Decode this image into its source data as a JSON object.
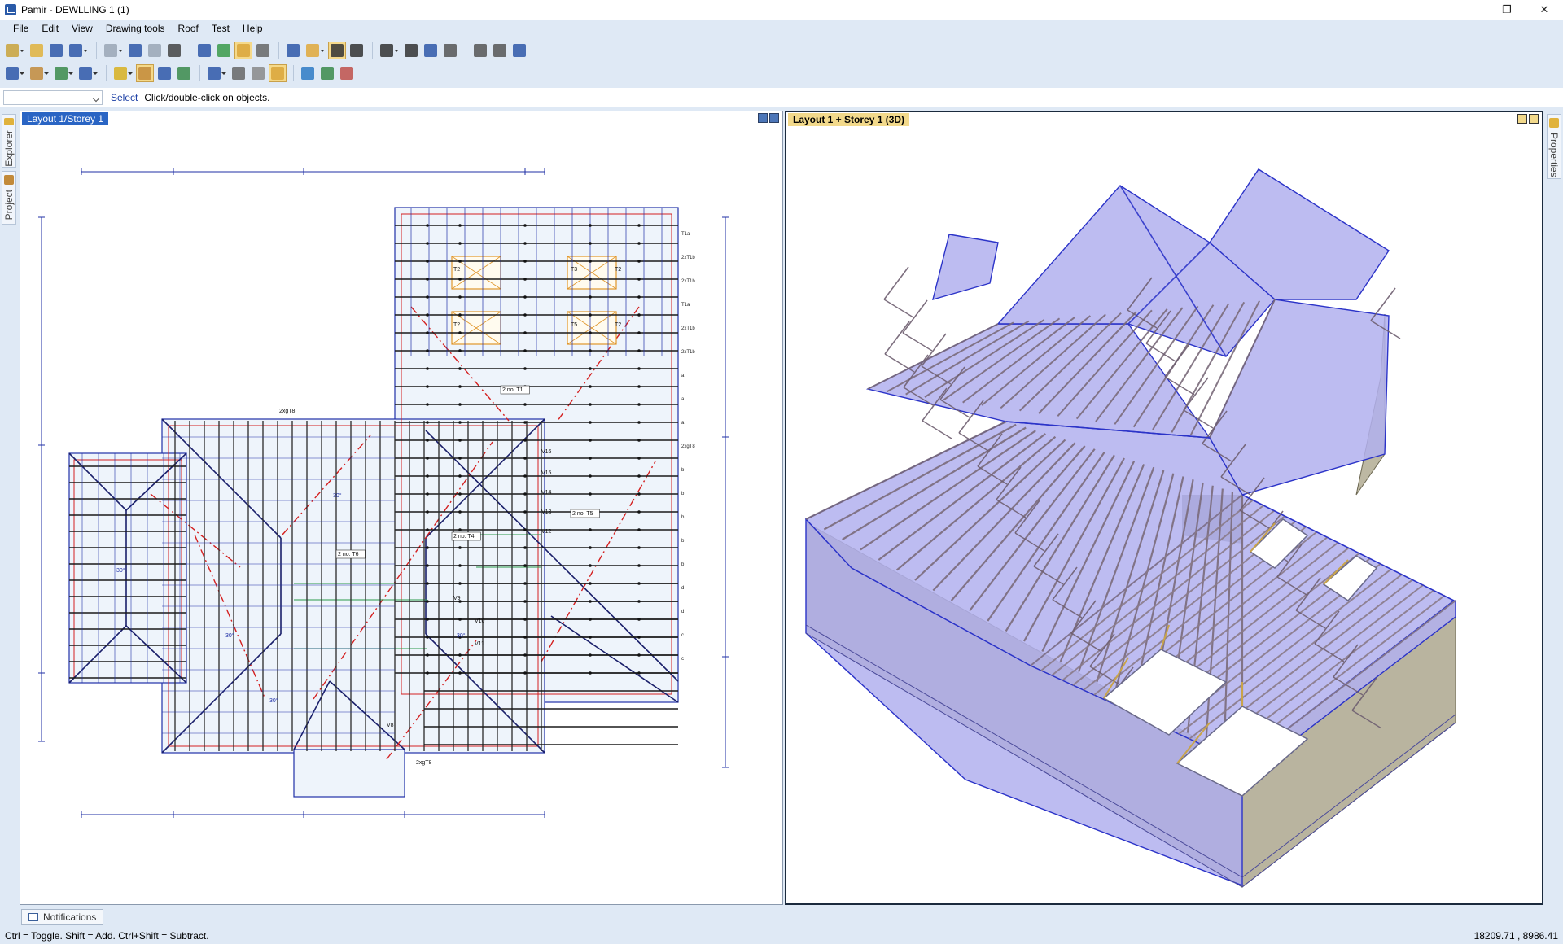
{
  "window": {
    "title": "Pamir - DEWLLING 1 (1)",
    "controls": [
      "–",
      "❐",
      "✕"
    ]
  },
  "menu": [
    "File",
    "Edit",
    "View",
    "Drawing tools",
    "Roof",
    "Test",
    "Help"
  ],
  "toolbar1": [
    {
      "icon": "new-file-icon",
      "color": "#c9a23a",
      "drop": true
    },
    {
      "icon": "open-folder-icon",
      "color": "#e0b23c"
    },
    {
      "icon": "save-icon",
      "color": "#2e57a8"
    },
    {
      "icon": "undo-icon",
      "color": "#2e57a8",
      "drop": true
    },
    {
      "icon": "redo-icon",
      "color": "#9aa6b5",
      "drop": true
    },
    {
      "icon": "copy-icon",
      "color": "#2e57a8"
    },
    {
      "icon": "paste-icon",
      "color": "#9aa6b5"
    },
    {
      "icon": "edit-icon",
      "color": "#444"
    },
    {
      "icon": "image-icon",
      "color": "#2e57a8"
    },
    {
      "icon": "roof-view-icon",
      "color": "#3a9a4a"
    },
    {
      "icon": "layers-icon",
      "color": "#d9a53a",
      "active": true
    },
    {
      "icon": "text-frame-icon",
      "color": "#666"
    },
    {
      "icon": "print-icon",
      "color": "#2e57a8"
    },
    {
      "icon": "pencil-icon",
      "color": "#e0a83a",
      "drop": true
    },
    {
      "icon": "select-cursor-icon",
      "color": "#333",
      "active": true
    },
    {
      "icon": "move-cursor-icon",
      "color": "#333"
    },
    {
      "icon": "zoom-icon",
      "color": "#333",
      "drop": true
    },
    {
      "icon": "measure-icon",
      "color": "#333"
    },
    {
      "icon": "link-icon",
      "color": "#2e57a8"
    },
    {
      "icon": "truss-icon",
      "color": "#555"
    },
    {
      "icon": "frame-icon",
      "color": "#555"
    },
    {
      "icon": "wrench-icon",
      "color": "#555"
    },
    {
      "icon": "display-icon",
      "color": "#2e57a8"
    }
  ],
  "toolbar2": [
    {
      "icon": "roof-plane-icon",
      "color": "#2e57a8",
      "drop": true
    },
    {
      "icon": "hip-roof-icon",
      "color": "#c28a3a",
      "drop": true
    },
    {
      "icon": "gable-icon",
      "color": "#3a8a4a",
      "drop": true
    },
    {
      "icon": "dormer-icon",
      "color": "#2e57a8",
      "drop": true
    },
    {
      "icon": "lightning-icon",
      "color": "#d8b020",
      "drop": true
    },
    {
      "icon": "truss-layout-icon",
      "color": "#c28a3a",
      "active": true
    },
    {
      "icon": "beam-icon",
      "color": "#2e57a8"
    },
    {
      "icon": "tie-icon",
      "color": "#3a8a4a"
    },
    {
      "icon": "group-icon",
      "color": "#2e57a8",
      "drop": true
    },
    {
      "icon": "rotate-icon",
      "color": "#666"
    },
    {
      "icon": "mirror-icon",
      "color": "#888"
    },
    {
      "icon": "check-icon",
      "color": "#d9a53a",
      "active": true
    },
    {
      "icon": "validate-icon",
      "color": "#2e7ac4"
    },
    {
      "icon": "tools-icon",
      "color": "#3a8a4a"
    },
    {
      "icon": "box-3d-icon",
      "color": "#c0504a"
    }
  ],
  "command": {
    "mode": "Select",
    "hint": "Click/double-click on objects."
  },
  "left_tabs": [
    {
      "label": "Explorer",
      "icon": "explorer-icon"
    },
    {
      "label": "Project",
      "icon": "house-icon"
    }
  ],
  "right_tabs": [
    {
      "label": "Properties",
      "icon": "properties-icon"
    }
  ],
  "viewport_2d": {
    "title": "Layout 1/Storey 1",
    "row_labels": [
      "T1a",
      "2xT1b",
      "2xT1b",
      "T1a",
      "2xT1b",
      "2xT1b",
      "a",
      "a",
      "a",
      "2xgT8",
      "b",
      "b",
      "b",
      "b",
      "b",
      "d",
      "d",
      "c",
      "c"
    ],
    "tags": [
      "T2",
      "T3",
      "T2",
      "T2",
      "T5",
      "T2",
      "V16",
      "V15",
      "V14",
      "V13",
      "V12",
      "V9",
      "V10",
      "V11",
      "V8",
      "2xgT8",
      "2xgT8"
    ],
    "callouts": [
      "2 no. T1",
      "2 no. T4",
      "2 no. T5",
      "2 no. T6"
    ],
    "angles": [
      "30°",
      "30°",
      "30°",
      "30°",
      "30°"
    ]
  },
  "viewport_3d": {
    "title": "Layout 1 + Storey 1 (3D)"
  },
  "notifications": {
    "label": "Notifications"
  },
  "status": {
    "hint": "Ctrl = Toggle. Shift = Add.  Ctrl+Shift = Subtract.",
    "coords": "18209.71 , 8986.41"
  }
}
